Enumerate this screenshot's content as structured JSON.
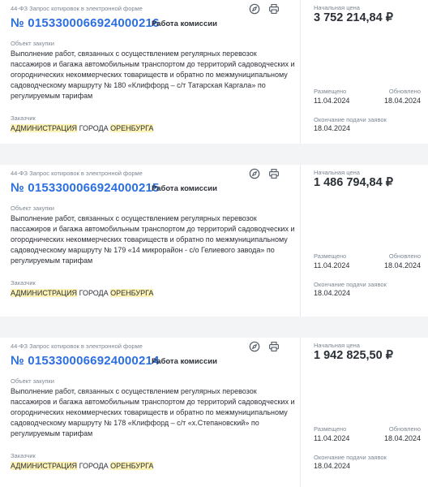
{
  "cards": [
    {
      "law": "44-ФЗ Запрос котировок в электронной форме",
      "number": "№ 0153300066924000216",
      "status": "Работа комиссии",
      "object_label": "Объект закупки",
      "object_text": "Выполнение работ, связанных с осуществлением регулярных перевозок пассажиров и багажа автомобильным транспортом до территорий садоводческих и огороднических некоммерческих товариществ и обратно по межмуниципальному садоводческому маршруту № 180 «Клиффорд – с/т Татарская Каргала» по регулируемым тарифам",
      "customer_label": "Заказчик",
      "customer": [
        "АДМИНИСТРАЦИЯ",
        "ГОРОДА",
        "ОРЕНБУРГА"
      ],
      "price_label": "Начальная цена",
      "price": "3 752 214,84 ₽",
      "posted_label": "Размещено",
      "posted": "11.04.2024",
      "updated_label": "Обновлено",
      "updated": "18.04.2024",
      "deadline_label": "Окончание подачи заявок",
      "deadline": "18.04.2024"
    },
    {
      "law": "44-ФЗ Запрос котировок в электронной форме",
      "number": "№ 0153300066924000215",
      "status": "Работа комиссии",
      "object_label": "Объект закупки",
      "object_text": "Выполнение работ, связанных с осуществлением регулярных перевозок пассажиров и багажа автомобильным транспортом до территорий садоводческих и огороднических некоммерческих товариществ и обратно по межмуниципальному садоводческому маршруту № 179 «14 микрорайон - с/о Гелиевого завода» по регулируемым тарифам",
      "customer_label": "Заказчик",
      "customer": [
        "АДМИНИСТРАЦИЯ",
        "ГОРОДА",
        "ОРЕНБУРГА"
      ],
      "price_label": "Начальная цена",
      "price": "1 486 794,84 ₽",
      "posted_label": "Размещено",
      "posted": "11.04.2024",
      "updated_label": "Обновлено",
      "updated": "18.04.2024",
      "deadline_label": "Окончание подачи заявок",
      "deadline": "18.04.2024"
    },
    {
      "law": "44-ФЗ Запрос котировок в электронной форме",
      "number": "№ 0153300066924000214",
      "status": "Работа комиссии",
      "object_label": "Объект закупки",
      "object_text": "Выполнение работ, связанных с осуществлением регулярных перевозок пассажиров и багажа автомобильным транспортом до территорий садоводческих и огороднических некоммерческих товариществ и обратно по межмуниципальному садоводческому маршруту № 178 «Клиффорд – с/т «х.Степановский» по регулируемым тарифам",
      "customer_label": "Заказчик",
      "customer": [
        "АДМИНИСТРАЦИЯ",
        "ГОРОДА",
        "ОРЕНБУРГА"
      ],
      "price_label": "Начальная цена",
      "price": "1 942 825,50 ₽",
      "posted_label": "Размещено",
      "posted": "11.04.2024",
      "updated_label": "Обновлено",
      "updated": "18.04.2024",
      "deadline_label": "Окончание подачи заявок",
      "deadline": "18.04.2024"
    }
  ],
  "icons": {
    "compass": "compass-icon",
    "print": "print-icon"
  },
  "colors": {
    "number": "#2c6fe0",
    "highlight": "#fdf3b6",
    "text": "#2b2f36",
    "muted": "#7e8794",
    "background": "#f3f4f6"
  }
}
